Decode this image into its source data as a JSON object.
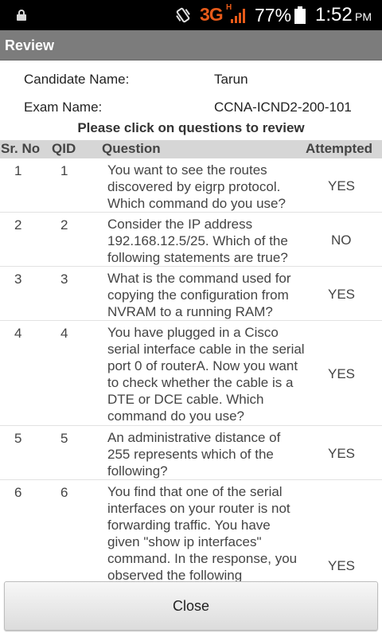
{
  "status_bar": {
    "network": "3G",
    "network_sub": "H",
    "battery": "77%",
    "time": "1:52",
    "ampm": "PM",
    "icons": [
      "lock-icon",
      "vibrate-icon",
      "signal-icon",
      "battery-icon"
    ]
  },
  "header": {
    "title": "Review"
  },
  "candidate": {
    "name_label": "Candidate Name:",
    "name_value": "Tarun",
    "exam_label": "Exam Name:",
    "exam_value": "CCNA-ICND2-200-101"
  },
  "instruction": "Please click on questions to review",
  "table": {
    "columns": [
      "Sr. No",
      "QID",
      "Question",
      "Attempted"
    ],
    "rows": [
      {
        "sr": "1",
        "qid": "1",
        "question": "You want to see the routes discovered by eigrp protocol. Which command do you use?",
        "attempted": "YES"
      },
      {
        "sr": "2",
        "qid": "2",
        "question": "Consider the IP address 192.168.12.5/25. Which of the following statements are true?",
        "attempted": "NO"
      },
      {
        "sr": "3",
        "qid": "3",
        "question": "What is the command used for copying the configuration from NVRAM to a running RAM?",
        "attempted": "YES"
      },
      {
        "sr": "4",
        "qid": "4",
        "question": "You have plugged in a Cisco serial interface cable in the serial port 0 of routerA. Now you want to check whether the cable is a DTE or DCE cable. Which command do you use?",
        "attempted": "YES"
      },
      {
        "sr": "5",
        "qid": "5",
        "question": "An administrative distance of 255 represents which of the following?",
        "attempted": "YES"
      },
      {
        "sr": "6",
        "qid": "6",
        "question": "You find that one of the serial interfaces on your router is not forwarding traffic. You have given \"show ip interfaces\" command. In the response, you observed the following",
        "attempted": "YES"
      }
    ]
  },
  "close_label": "Close",
  "colors": {
    "title_bar": "#7c7c7c",
    "network_accent": "#e65a19",
    "header_row": "#d6d6d6"
  }
}
